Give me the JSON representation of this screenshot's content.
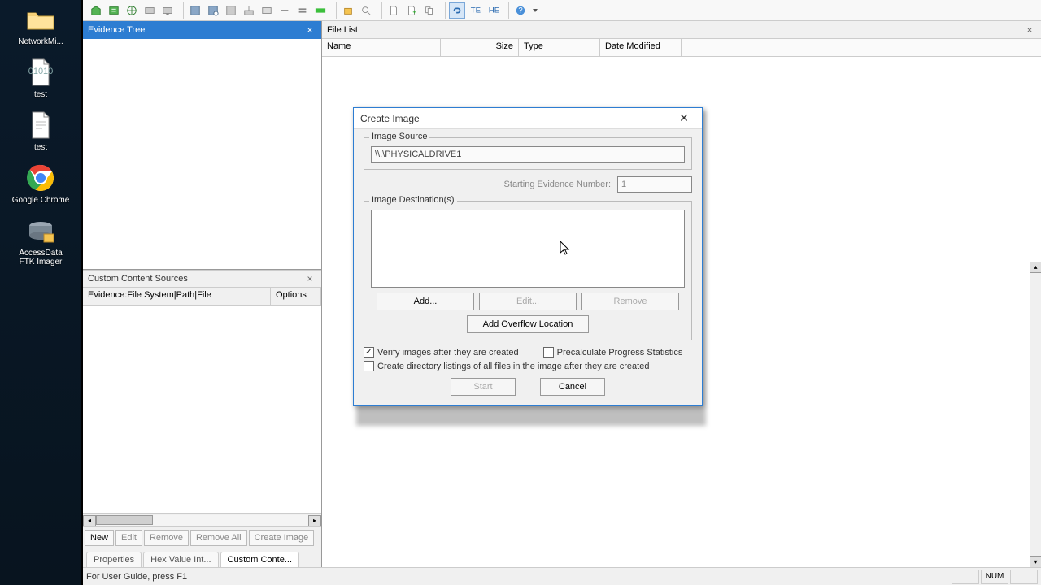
{
  "desktop": {
    "items": [
      {
        "label": "NetworkMi...",
        "icon": "folder"
      },
      {
        "label": "test",
        "icon": "textfile"
      },
      {
        "label": "test",
        "icon": "textfile"
      },
      {
        "label": "Google Chrome",
        "icon": "chrome"
      },
      {
        "label": "AccessData FTK Imager",
        "icon": "ftk"
      }
    ]
  },
  "toolbar": {
    "icons": [
      "add-evidence",
      "add-all",
      "net-drive",
      "image-mount",
      "image-mount2",
      "sep",
      "disk",
      "disk-info",
      "disk-eject",
      "capture",
      "export",
      "detach",
      "equals",
      "green-strip",
      "sep",
      "open-box",
      "zoom",
      "sep",
      "new-doc",
      "doc-add",
      "doc-multi",
      "sep",
      "link",
      "text-mode",
      "hex-mode",
      "sep",
      "help",
      "dropdown"
    ]
  },
  "panels": {
    "evidence_tree": {
      "title": "Evidence Tree"
    },
    "custom_sources": {
      "title": "Custom Content Sources",
      "columns": {
        "c1": "Evidence:File System|Path|File",
        "c2": "Options"
      },
      "buttons": {
        "new": "New",
        "edit": "Edit",
        "remove": "Remove",
        "remove_all": "Remove All",
        "create_image": "Create Image"
      }
    },
    "file_list": {
      "title": "File List",
      "columns": {
        "name": "Name",
        "size": "Size",
        "type": "Type",
        "date": "Date Modified"
      }
    },
    "bottom_tabs": {
      "properties": "Properties",
      "hex": "Hex Value Int...",
      "custom": "Custom Conte..."
    }
  },
  "statusbar": {
    "msg": "For User Guide, press F1",
    "num": "NUM"
  },
  "dialog": {
    "title": "Create Image",
    "image_source_legend": "Image Source",
    "image_source_value": "\\\\.\\PHYSICALDRIVE1",
    "starting_ev_label": "Starting Evidence Number:",
    "starting_ev_value": "1",
    "dest_legend": "Image Destination(s)",
    "btn_add": "Add...",
    "btn_edit": "Edit...",
    "btn_remove": "Remove",
    "btn_overflow": "Add Overflow Location",
    "chk_verify": "Verify images after they are created",
    "chk_precalc": "Precalculate Progress Statistics",
    "chk_dirlist": "Create directory listings of all files in the image after they are created",
    "btn_start": "Start",
    "btn_cancel": "Cancel"
  }
}
